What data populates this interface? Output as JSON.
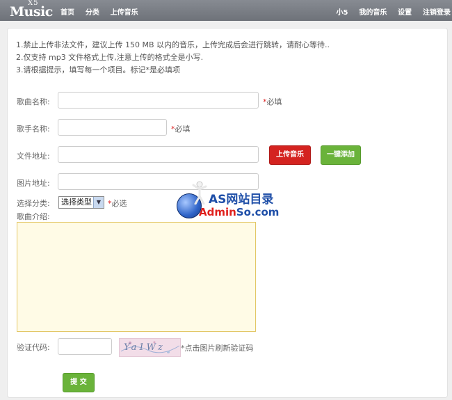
{
  "nav": {
    "logo_main": "Music",
    "logo_sup": "X5",
    "left_items": [
      "首页",
      "分类",
      "上传音乐"
    ],
    "right_items": [
      "小5",
      "我的音乐",
      "设置",
      "注销登录"
    ]
  },
  "notes": [
    "1.禁止上传非法文件，建议上传 150 MB 以内的音乐，上传完成后会进行跳转，请耐心等待..",
    "2.仅支持 mp3 文件格式上传,注意上传的格式全是小写.",
    "3.请根据提示，填写每一个项目。标记*是必填项"
  ],
  "form": {
    "song_name_label": "歌曲名称:",
    "song_name_value": "",
    "singer_label": "歌手名称:",
    "singer_value": "",
    "file_label": "文件地址:",
    "file_value": "",
    "image_label": "图片地址:",
    "image_value": "",
    "category_label": "选择分类:",
    "category_selected": "选择类型",
    "intro_label": "歌曲介绍:",
    "captcha_label": "验证代码:",
    "captcha_value": "",
    "captcha_image_text": "Ya1Wz",
    "captcha_hint": "*点击图片刷新验证码",
    "required_star": "*",
    "required_fill": "必填",
    "required_select": "必选",
    "upload_button": "上传音乐",
    "quick_add_button": "一键添加",
    "submit_button": "提 交"
  },
  "watermark": {
    "line1": "AS网站目录",
    "line2_red": "Admin",
    "line2_blue": "So.com"
  },
  "colors": {
    "nav_bg": "#7b7f86",
    "required_star": "#dd2222",
    "upload_button": "#d42320",
    "green_button": "#6ab33a",
    "textarea_bg": "#fffbe6",
    "watermark_blue": "#1f4fa8",
    "watermark_red": "#e0201c"
  }
}
